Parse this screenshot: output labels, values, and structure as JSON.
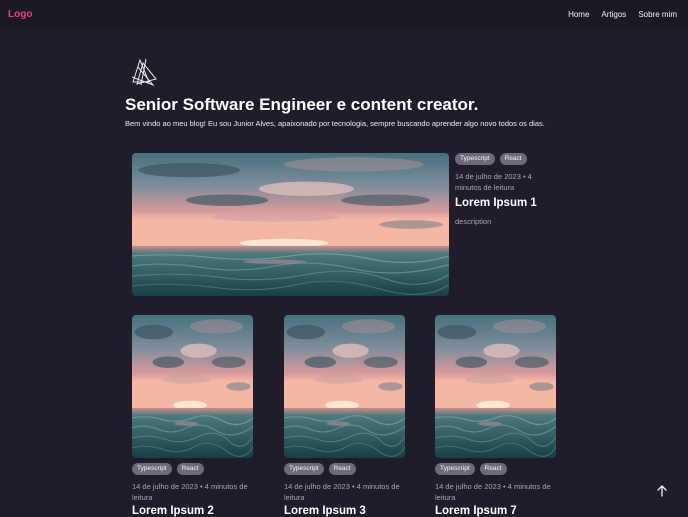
{
  "nav": {
    "logo": "Logo",
    "links": [
      "Home",
      "Artigos",
      "Sobre mim"
    ]
  },
  "hero": {
    "logo_icon": "triangle-logo-icon",
    "title": "Senior Software Engineer e content creator.",
    "text": "Bem vindo ao meu blog! Eu sou Junior Alves, apaixonado por tecnologia, sempre buscando aprender algo novo todos os dias."
  },
  "featured": {
    "tags": [
      "Typescript",
      "React"
    ],
    "meta_line1": "14 de julho de 2023 • 4",
    "meta_line2": "minutos de leitura",
    "title": "Lorem Ipsum 1",
    "description": "description"
  },
  "posts": [
    {
      "tags": [
        "Typescript",
        "React"
      ],
      "meta_line1": "14 de julho de 2023 • 4 minutos de",
      "meta_line2": "leitura",
      "title": "Lorem Ipsum 2"
    },
    {
      "tags": [
        "Typescript",
        "React"
      ],
      "meta_line1": "14 de julho de 2023 • 4 minutos de",
      "meta_line2": "leitura",
      "title": "Lorem Ipsum 3"
    },
    {
      "tags": [
        "Typescript",
        "React"
      ],
      "meta_line1": "14 de julho de 2023 • 4 minutos de",
      "meta_line2": "leitura",
      "title": "Lorem Ipsum 7"
    }
  ],
  "scroll_top_icon": "arrow-up-icon",
  "colors": {
    "background": "#201d2a",
    "logo": "#e8417f",
    "tag": "#6d6c76",
    "meta": "#a9a7b1"
  }
}
